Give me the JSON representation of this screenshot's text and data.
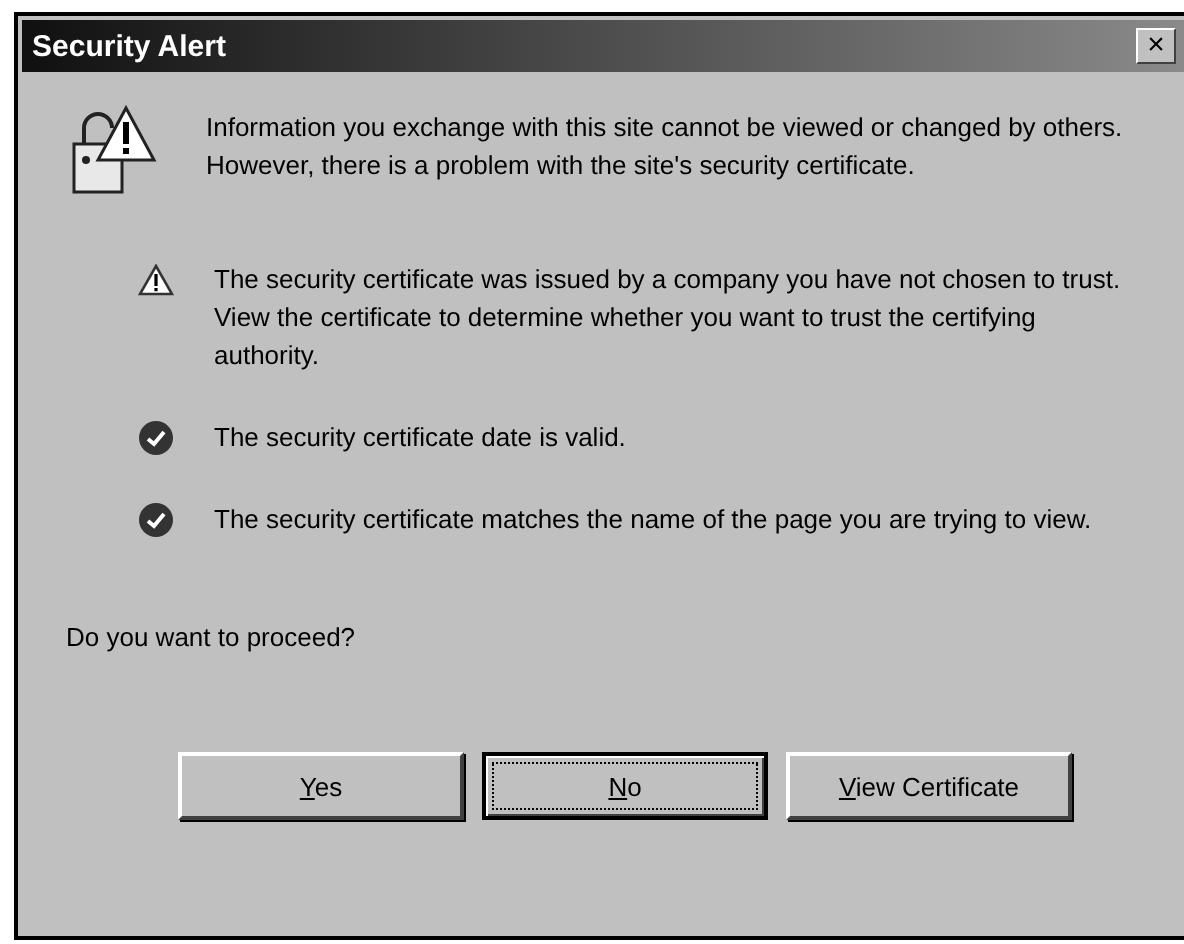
{
  "window": {
    "title": "Security Alert",
    "close_label": "×"
  },
  "intro": "Information you exchange with this site cannot be viewed or changed by others. However, there is a problem with the site's security certificate.",
  "items": [
    {
      "kind": "warning",
      "text": "The security certificate was issued by a company you have not chosen to trust. View the certificate to determine whether you want to trust the certifying authority."
    },
    {
      "kind": "check",
      "text": "The security certificate date is valid."
    },
    {
      "kind": "check",
      "text": "The security certificate matches the name of the page you are trying to view."
    }
  ],
  "question": "Do you want to proceed?",
  "buttons": [
    {
      "mnemonic": "Y",
      "rest": "es",
      "default": false
    },
    {
      "mnemonic": "N",
      "rest": "o",
      "default": true
    },
    {
      "mnemonic": "V",
      "rest": "iew Certificate",
      "default": false
    }
  ]
}
